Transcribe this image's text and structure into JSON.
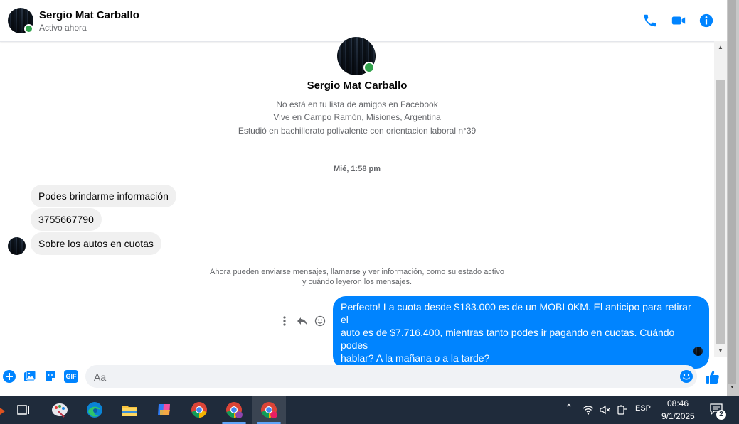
{
  "header": {
    "name": "Sergio Mat Carballo",
    "status": "Activo ahora"
  },
  "profile": {
    "name": "Sergio Mat Carballo",
    "info": [
      "No está en tu lista de amigos en Facebook",
      "Vive en Campo Ramón, Misiones, Argentina",
      "Estudió en bachillerato polivalente con orientacion laboral n°39"
    ]
  },
  "thread": {
    "timestamp": "Mié, 1:58 pm",
    "incoming": [
      "Podes brindarme información",
      "3755667790",
      "Sobre los autos en cuotas"
    ],
    "notice_line1": "Ahora pueden enviarse mensajes, llamarse y ver información, como su estado activo",
    "notice_line2": "y cuándo leyeron los mensajes.",
    "outgoing_line1": "Perfecto! La cuota desde $183.000 es de un MOBI 0KM. El anticipo para retirar el",
    "outgoing_line2": "auto es de $7.716.400, mientras tanto podes ir pagando en cuotas. Cuándo podes",
    "outgoing_line3": "hablar? A la mañana o a la tarde?"
  },
  "composer": {
    "placeholder": "Aa",
    "gif_label": "GIF"
  },
  "taskbar": {
    "language": "ESP",
    "time": "08:46",
    "date": "9/1/2025",
    "notifications": "2"
  },
  "colors": {
    "accent": "#0084ff",
    "online": "#31a24c",
    "bubble_in": "#f0f0f0"
  }
}
